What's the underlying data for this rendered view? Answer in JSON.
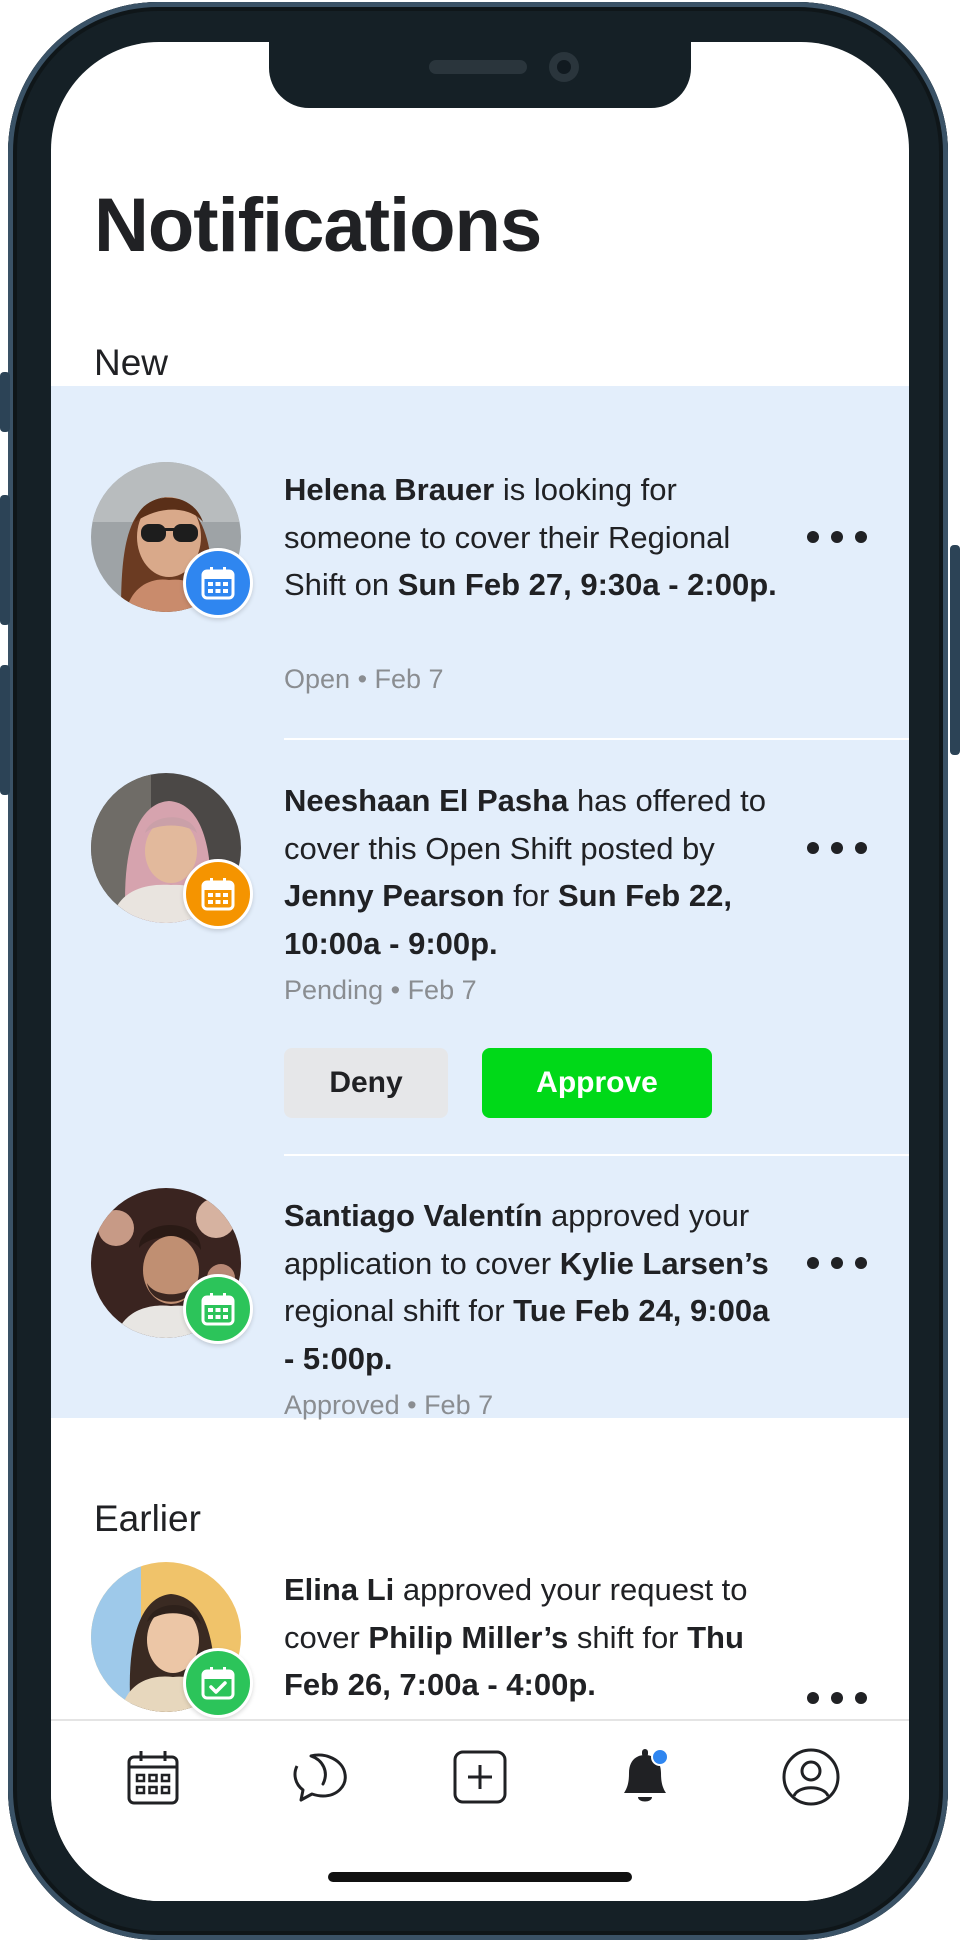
{
  "page": {
    "title": "Notifications"
  },
  "sections": {
    "new_label": "New",
    "earlier_label": "Earlier"
  },
  "notifications": [
    {
      "name1": "Helena Brauer",
      "t1": " is looking for someone to cover their Regional Shift on ",
      "name2": "Sun Feb 27, 9:30a - 2:00p.",
      "status": "Open",
      "date": "Feb 7",
      "badge_color": "#2f86f0",
      "badge_icon": "calendar-icon"
    },
    {
      "name1": "Neeshaan El Pasha",
      "t1": " has offered to cover this Open Shift posted by ",
      "name2": "Jenny Pearson",
      "t2": " for ",
      "name3": "Sun Feb 22, 10:00a - 9:00p.",
      "status": "Pending",
      "date": "Feb 7",
      "badge_color": "#f59400",
      "badge_icon": "calendar-icon",
      "deny_label": "Deny",
      "approve_label": "Approve"
    },
    {
      "name1": "Santiago Valentín",
      "t1": " approved your application to cover ",
      "name2": "Kylie Larsen’s",
      "t2": " regional shift for ",
      "name3": "Tue Feb 24, 9:00a - 5:00p.",
      "status": "Approved",
      "date": "Feb 7",
      "badge_color": "#2cc45a",
      "badge_icon": "calendar-icon"
    },
    {
      "name1": "Elina Li",
      "t1": " approved your request to cover ",
      "name2": "Philip Miller’s",
      "t2": " shift for ",
      "name3": "Thu Feb 26, 7:00a - 4:00p.",
      "badge_color": "#2cc45a",
      "badge_icon": "calendar-check-icon"
    }
  ],
  "meta_separator": " • ",
  "tabbar": {
    "items": [
      "calendar-icon",
      "chat-icon",
      "add-icon",
      "bell-icon",
      "profile-icon"
    ],
    "active_dot_color": "#2f86f0"
  }
}
